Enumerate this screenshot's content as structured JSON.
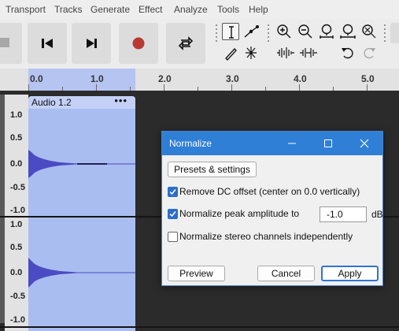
{
  "menu": [
    "Transport",
    "Tracks",
    "Generate",
    "Effect",
    "Analyze",
    "Tools",
    "Help"
  ],
  "ruler": {
    "ticks": [
      "0.0",
      "1.0",
      "2.0",
      "3.0",
      "4.0",
      "5.0"
    ]
  },
  "track": {
    "clip_title": "Audio 1.2",
    "clip_menu": "•••",
    "vruler_top": [
      "1.0",
      "0.5",
      "0.0",
      "-0.5",
      "-1.0"
    ],
    "vruler_bottom": [
      "1.0",
      "0.5",
      "0.0",
      "-0.5",
      "-1.0"
    ]
  },
  "dialog": {
    "title": "Normalize",
    "presets_label": "Presets & settings",
    "remove_dc_label": "Remove DC offset (center on 0.0 vertically)",
    "remove_dc_checked": true,
    "normalize_peak_label": "Normalize peak amplitude to",
    "normalize_peak_checked": true,
    "peak_value": "-1.0",
    "peak_unit": "dB",
    "stereo_label": "Normalize stereo channels independently",
    "stereo_checked": false,
    "preview_label": "Preview",
    "cancel_label": "Cancel",
    "apply_label": "Apply"
  },
  "colors": {
    "accent": "#2f7fd6",
    "record": "#b83a32",
    "clip": "#aabdf0",
    "waveform": "#4b4bc4"
  },
  "icons": [
    "stop-icon",
    "skip-to-start-icon",
    "skip-to-end-icon",
    "record-icon",
    "loop-icon",
    "selection-tool-icon",
    "envelope-tool-icon",
    "draw-tool-icon",
    "multi-tool-icon",
    "zoom-in-icon",
    "zoom-out-icon",
    "fit-selection-icon",
    "fit-project-icon",
    "zoom-toggle-icon",
    "trim-audio-icon",
    "silence-audio-icon",
    "undo-icon",
    "redo-icon",
    "minimize-icon",
    "maximize-icon",
    "close-icon"
  ]
}
